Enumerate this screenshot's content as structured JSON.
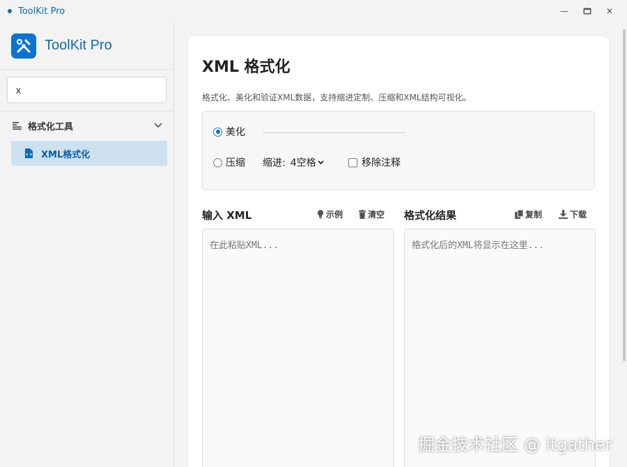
{
  "window": {
    "title": "ToolKit Pro",
    "controls": {
      "minimize": "—",
      "maximize": "▀",
      "close": "✕"
    }
  },
  "sidebar": {
    "brand": "ToolKit Pro",
    "search": {
      "value": "x",
      "placeholder": ""
    },
    "group": {
      "label": "格式化工具",
      "expanded": true
    },
    "items": [
      {
        "label": "XML格式化",
        "active": true
      }
    ]
  },
  "main": {
    "title": "XML 格式化",
    "description": "格式化、美化和验证XML数据，支持缩进定制、压缩和XML结构可视化。",
    "options": {
      "beautify_label": "美化",
      "compress_label": "压缩",
      "mode_selected": "美化",
      "indent_label": "缩进:",
      "indent_value": "4空格",
      "remove_comments_label": "移除注释",
      "remove_comments_checked": false
    },
    "input": {
      "heading": "输入 XML",
      "example_label": "示例",
      "clear_label": "清空",
      "placeholder": "在此粘贴XML..."
    },
    "output": {
      "heading": "格式化结果",
      "copy_label": "复制",
      "download_label": "下载",
      "placeholder": "格式化后的XML将显示在这里..."
    }
  },
  "watermark": "掘金技术社区 @ itgather",
  "colors": {
    "accent": "#0b74d1",
    "active_bg": "#cde1f1"
  }
}
